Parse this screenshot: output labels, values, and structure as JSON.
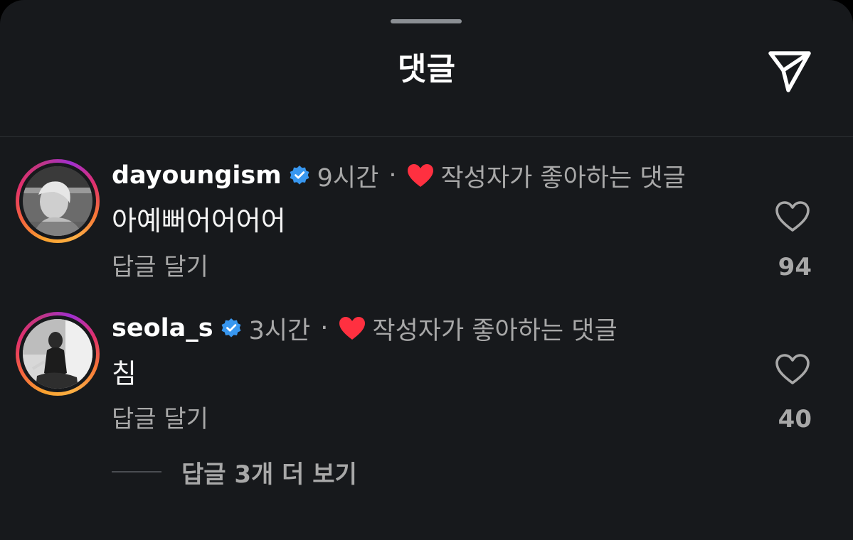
{
  "header": {
    "title": "댓글",
    "share_icon": "send-icon"
  },
  "comments": [
    {
      "username": "dayoungism",
      "verified": true,
      "time": "9시간",
      "separator": "·",
      "liked_by_author": "작성자가 좋아하는 댓글",
      "text": "아예뻐어어어어",
      "reply_label": "답글 달기",
      "like_count": "94"
    },
    {
      "username": "seola_s",
      "verified": true,
      "time": "3시간",
      "separator": "·",
      "liked_by_author": "작성자가 좋아하는 댓글",
      "text": "침",
      "reply_label": "답글 달기",
      "like_count": "40"
    }
  ],
  "view_replies": "답글 3개 더 보기",
  "colors": {
    "background": "#17191c",
    "verified_badge": "#3897f0",
    "heart_red": "#ff3040",
    "muted_text": "#a8a8a8"
  }
}
